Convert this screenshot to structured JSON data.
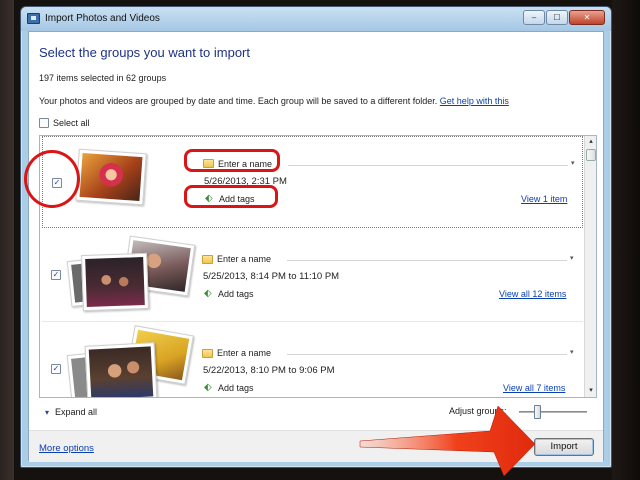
{
  "window": {
    "title": "Import Photos and Videos",
    "controls": {
      "minimize": "–",
      "maximize": "☐",
      "close": "✕"
    }
  },
  "main": {
    "heading": "Select the groups you want to import",
    "selection_count": "197 items selected in 62 groups",
    "description": "Your photos and videos are grouped by date and time. Each group will be saved to a different folder.",
    "help_link": "Get help with this",
    "select_all_label": "Select all",
    "select_all_checked": false
  },
  "groups": [
    {
      "checked": true,
      "name_placeholder": "Enter a name",
      "date": "5/26/2013, 2:31 PM",
      "tags_label": "Add tags",
      "view_link": "View 1 item",
      "selected": true
    },
    {
      "checked": true,
      "name_placeholder": "Enter a name",
      "date": "5/25/2013, 8:14 PM to 11:10 PM",
      "tags_label": "Add tags",
      "view_link": "View all 12 items",
      "selected": false
    },
    {
      "checked": true,
      "name_placeholder": "Enter a name",
      "date": "5/22/2013, 8:10 PM to 9:06 PM",
      "tags_label": "Add tags",
      "view_link": "View all 7 items",
      "selected": false
    }
  ],
  "bottom": {
    "expand_all": "Expand all",
    "adjust_groups": "Adjust groups:",
    "adjust_groups_level": 0.25,
    "more_options": "More options",
    "import_button": "Import"
  },
  "icons": {
    "check": "✓",
    "dropdown": "▾",
    "scroll_up": "▴",
    "scroll_down": "▾",
    "expand": "▾",
    "tag": "⬖"
  },
  "colors": {
    "heading": "#1e3287",
    "link": "#0a3fb0",
    "annotation_red": "#d91515"
  }
}
